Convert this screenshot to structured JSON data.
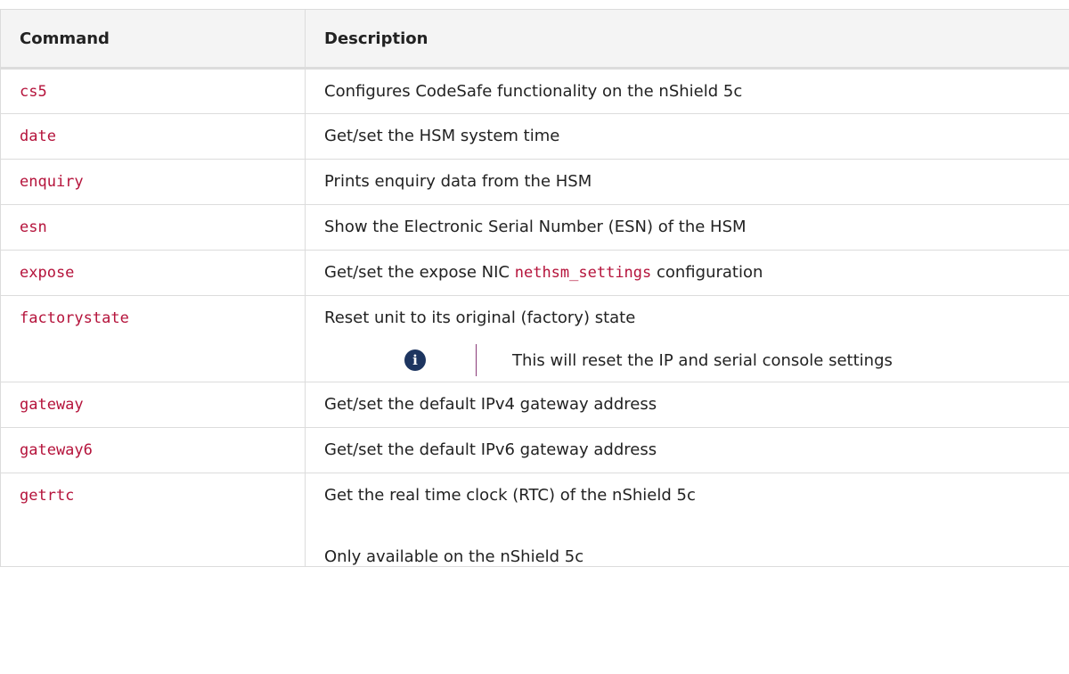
{
  "table": {
    "headers": {
      "command": "Command",
      "description": "Description"
    },
    "rows": [
      {
        "command": "cs5",
        "description": "Configures CodeSafe functionality on the nShield 5c"
      },
      {
        "command": "date",
        "description": "Get/set the HSM system time"
      },
      {
        "command": "enquiry",
        "description": "Prints enquiry data from the HSM"
      },
      {
        "command": "esn",
        "description": "Show the Electronic Serial Number (ESN) of the HSM"
      },
      {
        "command": "expose",
        "description_before": "Get/set the expose NIC ",
        "description_code": "nethsm_settings",
        "description_after": " configuration"
      },
      {
        "command": "factorystate",
        "description": "Reset unit to its original (factory) state",
        "note": "This will reset the IP and serial console settings",
        "note_icon": "info-icon"
      },
      {
        "command": "gateway",
        "description": "Get/set the default IPv4 gateway address"
      },
      {
        "command": "gateway6",
        "description": "Get/set the default IPv6 gateway address"
      },
      {
        "command": "getrtc",
        "description": "Get the real time clock (RTC) of the nShield 5c",
        "extra": "Only available on the nShield 5c"
      }
    ]
  },
  "colors": {
    "command_text": "#b5133b",
    "header_bg": "#f4f4f4",
    "border": "#dcdcdc",
    "note_icon_bg": "#1d3560",
    "note_divider": "#8a3a78"
  }
}
